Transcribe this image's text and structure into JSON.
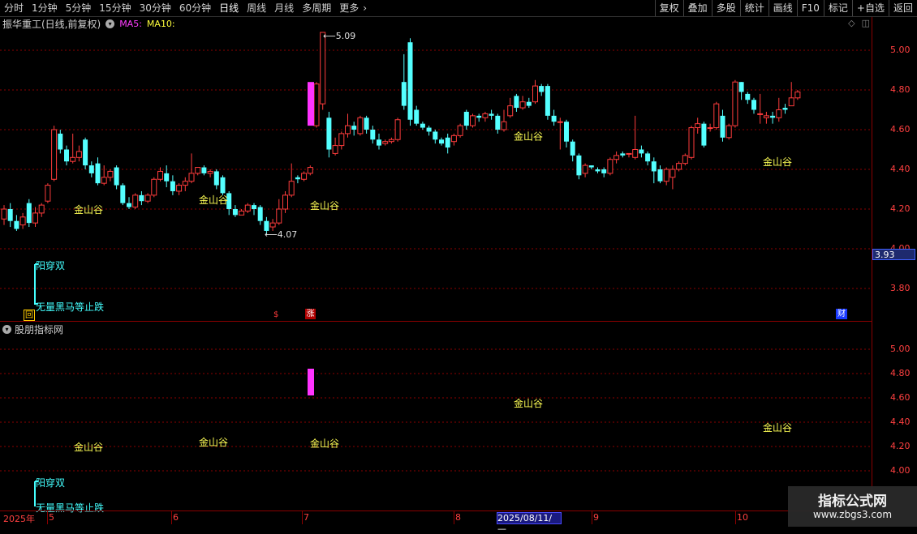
{
  "toolbar": {
    "periods": [
      "分时",
      "1分钟",
      "5分钟",
      "15分钟",
      "30分钟",
      "60分钟",
      "日线",
      "周线",
      "月线",
      "多周期",
      "更多"
    ],
    "active_period": "日线",
    "more_arrow": "›",
    "right_buttons": [
      "复权",
      "叠加",
      "多股",
      "统计",
      "画线",
      "F10",
      "标记",
      "+自选",
      "返回"
    ]
  },
  "info": {
    "stock_title": "振华重工(日线,前复权)",
    "ma5_label": "MA5:",
    "ma10_label": "MA10:"
  },
  "main_axis": {
    "labels": [
      "5.00",
      "4.80",
      "4.60",
      "4.40",
      "4.20",
      "4.00",
      "3.80"
    ],
    "current_price": "3.93"
  },
  "sub_axis": {
    "labels": [
      "5.00",
      "4.80",
      "4.60",
      "4.40",
      "4.20",
      "4.00"
    ]
  },
  "sub_panel": {
    "title": "股朋指标网"
  },
  "annotations": {
    "high_label": "5.09",
    "low_label": "4.07",
    "signal": "金山谷",
    "legend_a": "阳穿双",
    "legend_b": "无量黑马等止跌",
    "marker_box": "回",
    "marker_s": "$",
    "marker_zhang": "涨",
    "marker_cai": "财"
  },
  "date_axis": {
    "year": "2025年",
    "months": [
      "5",
      "6",
      "7",
      "8",
      "9",
      "10"
    ],
    "cursor": "2025/08/11/—"
  },
  "watermark": {
    "line1": "指标公式网",
    "line2": "www.zbgs3.com"
  },
  "colors": {
    "up": "#ff3c3c",
    "down": "#54ffff",
    "grid": "#8b0000",
    "magenta": "#ff33ff",
    "signal": "#ffff55"
  },
  "chart_data": {
    "type": "candlestick",
    "y_range_main": [
      3.64,
      5.2
    ],
    "y_range_sub": [
      3.9,
      5.2
    ],
    "candles": [
      [
        4.15,
        4.2,
        4.12,
        4.22
      ],
      [
        4.2,
        4.14,
        4.11,
        4.23
      ],
      [
        4.14,
        4.1,
        4.09,
        4.17
      ],
      [
        4.12,
        4.16,
        4.1,
        4.18
      ],
      [
        4.23,
        4.13,
        4.11,
        4.25
      ],
      [
        4.13,
        4.18,
        4.11,
        4.21
      ],
      [
        4.18,
        4.22,
        4.16,
        4.23
      ],
      [
        4.24,
        4.32,
        4.23,
        4.33
      ],
      [
        4.35,
        4.6,
        4.34,
        4.62
      ],
      [
        4.58,
        4.5,
        4.48,
        4.6
      ],
      [
        4.5,
        4.44,
        4.42,
        4.52
      ],
      [
        4.44,
        4.46,
        4.43,
        4.58
      ],
      [
        4.46,
        4.49,
        4.44,
        4.52
      ],
      [
        4.55,
        4.42,
        4.4,
        4.56
      ],
      [
        4.42,
        4.38,
        4.36,
        4.44
      ],
      [
        4.43,
        4.33,
        4.32,
        4.46
      ],
      [
        4.33,
        4.36,
        4.32,
        4.42
      ],
      [
        4.36,
        4.39,
        4.34,
        4.4
      ],
      [
        4.41,
        4.32,
        4.3,
        4.42
      ],
      [
        4.32,
        4.23,
        4.22,
        4.33
      ],
      [
        4.23,
        4.21,
        4.2,
        4.26
      ],
      [
        4.21,
        4.27,
        4.2,
        4.28
      ],
      [
        4.27,
        4.24,
        4.22,
        4.29
      ],
      [
        4.24,
        4.27,
        4.23,
        4.28
      ],
      [
        4.27,
        4.35,
        4.26,
        4.36
      ],
      [
        4.35,
        4.39,
        4.34,
        4.41
      ],
      [
        4.38,
        4.34,
        4.31,
        4.42
      ],
      [
        4.34,
        4.29,
        4.27,
        4.37
      ],
      [
        4.29,
        4.32,
        4.27,
        4.33
      ],
      [
        4.32,
        4.34,
        4.29,
        4.36
      ],
      [
        4.34,
        4.38,
        4.33,
        4.48
      ],
      [
        4.38,
        4.41,
        4.37,
        4.41
      ],
      [
        4.41,
        4.38,
        4.37,
        4.42
      ],
      [
        4.38,
        4.39,
        4.36,
        4.4
      ],
      [
        4.39,
        4.32,
        4.3,
        4.4
      ],
      [
        4.36,
        4.28,
        4.27,
        4.37
      ],
      [
        4.28,
        4.2,
        4.17,
        4.29
      ],
      [
        4.2,
        4.17,
        4.16,
        4.22
      ],
      [
        4.17,
        4.19,
        4.17,
        4.2
      ],
      [
        4.19,
        4.22,
        4.18,
        4.23
      ],
      [
        4.22,
        4.2,
        4.17,
        4.23
      ],
      [
        4.21,
        4.14,
        4.12,
        4.22
      ],
      [
        4.14,
        4.09,
        4.07,
        4.16
      ],
      [
        4.11,
        4.13,
        4.09,
        4.15
      ],
      [
        4.13,
        4.2,
        4.12,
        4.25
      ],
      [
        4.2,
        4.27,
        4.18,
        4.29
      ],
      [
        4.27,
        4.34,
        4.26,
        4.43
      ],
      [
        4.36,
        4.35,
        4.33,
        4.37
      ],
      [
        4.35,
        4.38,
        4.34,
        4.39
      ],
      [
        4.38,
        4.41,
        4.37,
        4.42
      ],
      [
        4.62,
        4.83,
        4.61,
        4.84
      ],
      [
        4.73,
        5.09,
        4.7,
        5.09
      ],
      [
        4.66,
        4.5,
        4.46,
        4.69
      ],
      [
        4.48,
        4.52,
        4.47,
        4.56
      ],
      [
        4.52,
        4.58,
        4.5,
        4.59
      ],
      [
        4.58,
        4.62,
        4.56,
        4.68
      ],
      [
        4.62,
        4.6,
        4.57,
        4.64
      ],
      [
        4.58,
        4.66,
        4.57,
        4.67
      ],
      [
        4.66,
        4.6,
        4.58,
        4.67
      ],
      [
        4.6,
        4.55,
        4.53,
        4.62
      ],
      [
        4.55,
        4.52,
        4.5,
        4.58
      ],
      [
        4.53,
        4.54,
        4.52,
        4.55
      ],
      [
        4.54,
        4.55,
        4.53,
        4.56
      ],
      [
        4.55,
        4.65,
        4.54,
        4.66
      ],
      [
        4.84,
        4.72,
        4.7,
        4.98
      ],
      [
        5.04,
        4.65,
        4.62,
        5.06
      ],
      [
        4.7,
        4.63,
        4.62,
        4.72
      ],
      [
        4.63,
        4.61,
        4.6,
        4.64
      ],
      [
        4.61,
        4.59,
        4.57,
        4.62
      ],
      [
        4.59,
        4.55,
        4.53,
        4.6
      ],
      [
        4.55,
        4.53,
        4.52,
        4.56
      ],
      [
        4.56,
        4.51,
        4.48,
        4.58
      ],
      [
        4.54,
        4.57,
        4.52,
        4.58
      ],
      [
        4.57,
        4.62,
        4.56,
        4.63
      ],
      [
        4.69,
        4.62,
        4.6,
        4.7
      ],
      [
        4.62,
        4.67,
        4.61,
        4.68
      ],
      [
        4.67,
        4.66,
        4.64,
        4.68
      ],
      [
        4.66,
        4.68,
        4.64,
        4.69
      ],
      [
        4.68,
        4.67,
        4.65,
        4.7
      ],
      [
        4.67,
        4.6,
        4.58,
        4.68
      ],
      [
        4.6,
        4.64,
        4.59,
        4.7
      ],
      [
        4.67,
        4.72,
        4.66,
        4.76
      ],
      [
        4.77,
        4.71,
        4.69,
        4.78
      ],
      [
        4.71,
        4.74,
        4.7,
        4.77
      ],
      [
        4.74,
        4.72,
        4.71,
        4.76
      ],
      [
        4.74,
        4.82,
        4.73,
        4.85
      ],
      [
        4.82,
        4.79,
        4.77,
        4.83
      ],
      [
        4.82,
        4.67,
        4.65,
        4.83
      ],
      [
        4.67,
        4.64,
        4.62,
        4.7
      ],
      [
        4.64,
        4.64,
        4.5,
        4.66
      ],
      [
        4.64,
        4.54,
        4.51,
        4.65
      ],
      [
        4.54,
        4.47,
        4.44,
        4.55
      ],
      [
        4.47,
        4.37,
        4.35,
        4.48
      ],
      [
        4.38,
        4.42,
        4.36,
        4.43
      ],
      [
        4.42,
        4.41,
        4.4,
        4.42
      ],
      [
        4.4,
        4.39,
        4.38,
        4.41
      ],
      [
        4.4,
        4.38,
        4.36,
        4.41
      ],
      [
        4.38,
        4.45,
        4.37,
        4.46
      ],
      [
        4.45,
        4.47,
        4.43,
        4.49
      ],
      [
        4.48,
        4.47,
        4.46,
        4.49
      ],
      [
        4.48,
        4.48,
        4.46,
        4.48
      ],
      [
        4.46,
        4.5,
        4.45,
        4.67
      ],
      [
        4.5,
        4.48,
        4.46,
        4.52
      ],
      [
        4.48,
        4.44,
        4.42,
        4.49
      ],
      [
        4.44,
        4.39,
        4.33,
        4.46
      ],
      [
        4.4,
        4.34,
        4.33,
        4.42
      ],
      [
        4.34,
        4.4,
        4.32,
        4.41
      ],
      [
        4.36,
        4.4,
        4.3,
        4.42
      ],
      [
        4.4,
        4.43,
        4.39,
        4.44
      ],
      [
        4.43,
        4.47,
        4.42,
        4.48
      ],
      [
        4.46,
        4.61,
        4.45,
        4.62
      ],
      [
        4.61,
        4.63,
        4.58,
        4.66
      ],
      [
        4.63,
        4.52,
        4.51,
        4.64
      ],
      [
        4.61,
        4.61,
        4.59,
        4.63
      ],
      [
        4.61,
        4.73,
        4.6,
        4.74
      ],
      [
        4.67,
        4.56,
        4.54,
        4.7
      ],
      [
        4.56,
        4.62,
        4.55,
        4.63
      ],
      [
        4.62,
        4.84,
        4.61,
        4.85
      ],
      [
        4.84,
        4.79,
        4.75,
        4.84
      ],
      [
        4.78,
        4.75,
        4.73,
        4.79
      ],
      [
        4.75,
        4.7,
        4.68,
        4.76
      ],
      [
        4.68,
        4.68,
        4.63,
        4.78
      ],
      [
        4.66,
        4.67,
        4.63,
        4.69
      ],
      [
        4.67,
        4.66,
        4.63,
        4.69
      ],
      [
        4.66,
        4.7,
        4.64,
        4.76
      ],
      [
        4.71,
        4.7,
        4.68,
        4.73
      ],
      [
        4.72,
        4.76,
        4.72,
        4.84
      ],
      [
        4.76,
        4.79,
        4.75,
        4.8
      ]
    ],
    "golden_valley_signals": [
      {
        "main_price": 4.2,
        "sub_price": 4.2
      },
      {
        "main_price": 4.25,
        "sub_price": 4.24
      },
      {
        "main_price": 4.22,
        "sub_price": 4.23
      },
      {
        "main_price": 4.57,
        "sub_price": 4.56
      },
      {
        "main_price": 4.44,
        "sub_price": 4.36
      }
    ]
  }
}
